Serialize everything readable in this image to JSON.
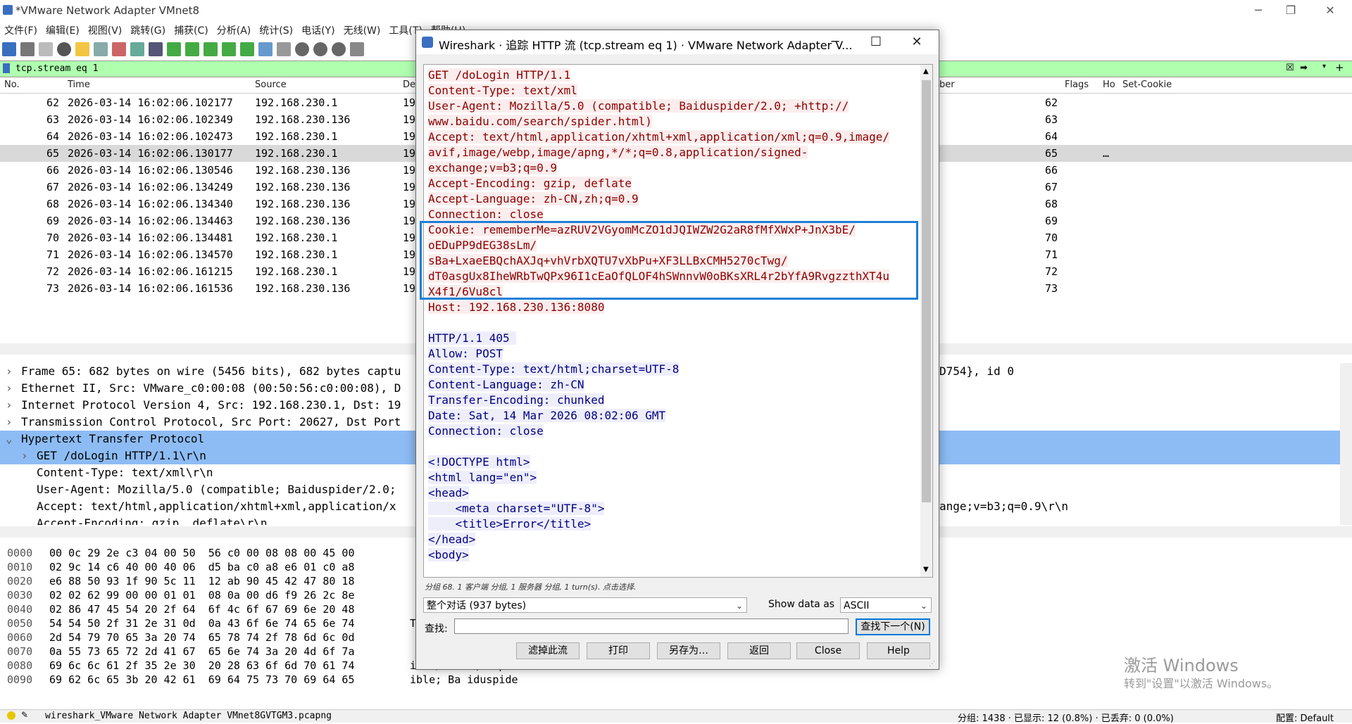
{
  "main_window": {
    "title": "*VMware Network Adapter VMnet8",
    "menu": [
      "文件(F)",
      "编辑(E)",
      "视图(V)",
      "跳转(G)",
      "捕获(C)",
      "分析(A)",
      "统计(S)",
      "电话(Y)",
      "无线(W)",
      "工具(T)",
      "帮助(H)"
    ],
    "filter": "tcp.stream eq 1",
    "columns": {
      "no": "No.",
      "time": "Time",
      "source": "Source",
      "dest": "De",
      "number": "ber",
      "flags": "Flags",
      "ho": "Ho",
      "set_cookie": "Set-Cookie"
    },
    "packets": [
      {
        "no": "62",
        "time": "2026-03-14 16:02:06.102177",
        "src": "192.168.230.1",
        "dst": "19",
        "num": "62",
        "flags": ""
      },
      {
        "no": "63",
        "time": "2026-03-14 16:02:06.102349",
        "src": "192.168.230.136",
        "dst": "19",
        "num": "63",
        "flags": ""
      },
      {
        "no": "64",
        "time": "2026-03-14 16:02:06.102473",
        "src": "192.168.230.1",
        "dst": "19",
        "num": "64",
        "flags": ""
      },
      {
        "no": "65",
        "time": "2026-03-14 16:02:06.130177",
        "src": "192.168.230.1",
        "dst": "19",
        "num": "65",
        "flags": "…"
      },
      {
        "no": "66",
        "time": "2026-03-14 16:02:06.130546",
        "src": "192.168.230.136",
        "dst": "19",
        "num": "66",
        "flags": ""
      },
      {
        "no": "67",
        "time": "2026-03-14 16:02:06.134249",
        "src": "192.168.230.136",
        "dst": "19",
        "num": "67",
        "flags": ""
      },
      {
        "no": "68",
        "time": "2026-03-14 16:02:06.134340",
        "src": "192.168.230.136",
        "dst": "19",
        "num": "68",
        "flags": ""
      },
      {
        "no": "69",
        "time": "2026-03-14 16:02:06.134463",
        "src": "192.168.230.136",
        "dst": "19",
        "num": "69",
        "flags": ""
      },
      {
        "no": "70",
        "time": "2026-03-14 16:02:06.134481",
        "src": "192.168.230.1",
        "dst": "19",
        "num": "70",
        "flags": ""
      },
      {
        "no": "71",
        "time": "2026-03-14 16:02:06.134570",
        "src": "192.168.230.1",
        "dst": "19",
        "num": "71",
        "flags": ""
      },
      {
        "no": "72",
        "time": "2026-03-14 16:02:06.161215",
        "src": "192.168.230.1",
        "dst": "19",
        "num": "72",
        "flags": ""
      },
      {
        "no": "73",
        "time": "2026-03-14 16:02:06.161536",
        "src": "192.168.230.136",
        "dst": "19",
        "num": "73",
        "flags": ""
      }
    ],
    "details": [
      {
        "text": "Frame 65: 682 bytes on wire (5456 bits), 682 bytes captu",
        "right": "D754}, id 0",
        "arrow": "›",
        "indent": 0
      },
      {
        "text": "Ethernet II, Src: VMware_c0:00:08 (00:50:56:c0:00:08), D",
        "right": "",
        "arrow": "›",
        "indent": 0
      },
      {
        "text": "Internet Protocol Version 4, Src: 192.168.230.1, Dst: 19",
        "right": "",
        "arrow": "›",
        "indent": 0
      },
      {
        "text": "Transmission Control Protocol, Src Port: 20627, Dst Port",
        "right": "",
        "arrow": "›",
        "indent": 0
      },
      {
        "text": "Hypertext Transfer Protocol",
        "right": "",
        "arrow": "⌄",
        "indent": 0
      },
      {
        "text": "GET /doLogin HTTP/1.1\\r\\n",
        "right": "",
        "arrow": "›",
        "indent": 1
      },
      {
        "text": "Content-Type: text/xml\\r\\n",
        "right": "",
        "arrow": "",
        "indent": 1
      },
      {
        "text": "User-Agent: Mozilla/5.0 (compatible; Baiduspider/2.0;",
        "right": "",
        "arrow": "",
        "indent": 1
      },
      {
        "text": "Accept: text/html,application/xhtml+xml,application/x",
        "right": "ange;v=b3;q=0.9\\r\\n",
        "arrow": "",
        "indent": 1
      },
      {
        "text": "Accept-Encoding: gzip, deflate\\r\\n",
        "right": "",
        "arrow": "",
        "indent": 1
      }
    ],
    "bytes": [
      {
        "off": "0000",
        "hex": "00 0c 29 2e c3 04 00 50  56 c0 00 08 08 00 45 00",
        "ascii": ""
      },
      {
        "off": "0010",
        "hex": "02 9c 14 c6 40 00 40 06  d5 ba c0 a8 e6 01 c0 a8",
        "ascii": ""
      },
      {
        "off": "0020",
        "hex": "e6 88 50 93 1f 90 5c 11  12 ab 90 45 42 47 80 18",
        "ascii": ""
      },
      {
        "off": "0030",
        "hex": "02 02 62 99 00 00 01 01  08 0a 00 d6 f9 26 2c 8e",
        "ascii": ""
      },
      {
        "off": "0040",
        "hex": "02 86 47 45 54 20 2f 64  6f 4c 6f 67 69 6e 20 48",
        "ascii": ""
      },
      {
        "off": "0050",
        "hex": "54 54 50 2f 31 2e 31 0d  0a 43 6f 6e 74 65 6e 74",
        "ascii": "T"
      },
      {
        "off": "0060",
        "hex": "2d 54 79 70 65 3a 20 74  65 78 74 2f 78 6d 6c 0d",
        "ascii": ""
      },
      {
        "off": "0070",
        "hex": "0a 55 73 65 72 2d 41 67  65 6e 74 3a 20 4d 6f 7a",
        "ascii": ""
      },
      {
        "off": "0080",
        "hex": "69 6c 6c 61 2f 35 2e 30  20 28 63 6f 6d 70 61 74",
        "ascii": "illa/5.0  (compat"
      },
      {
        "off": "0090",
        "hex": "69 62 6c 65 3b 20 42 61  69 64 75 73 70 69 64 65",
        "ascii": "ible; Ba iduspide"
      }
    ],
    "status": {
      "file": "wireshark_VMware Network Adapter VMnet8GVTGM3.pcapng",
      "packets": "分组: 1438 · 已显示: 12 (0.8%) · 已丢弃: 0 (0.0%)",
      "profile": "配置: Default"
    },
    "watermark": {
      "line1": "激活 Windows",
      "line2": "转到\"设置\"以激活 Windows。"
    }
  },
  "dialog": {
    "title": "Wireshark · 追踪 HTTP 流 (tcp.stream eq 1) · VMware Network Adapter V...",
    "stream_lines": [
      {
        "t": "GET /doLogin HTTP/1.1",
        "c": "cli"
      },
      {
        "t": "Content-Type: text/xml",
        "c": "cli"
      },
      {
        "t": "User-Agent: Mozilla/5.0 (compatible; Baiduspider/2.0; +http://",
        "c": "cli"
      },
      {
        "t": "www.baidu.com/search/spider.html)",
        "c": "cli"
      },
      {
        "t": "Accept: text/html,application/xhtml+xml,application/xml;q=0.9,image/",
        "c": "cli"
      },
      {
        "t": "avif,image/webp,image/apng,*/*;q=0.8,application/signed-",
        "c": "cli"
      },
      {
        "t": "exchange;v=b3;q=0.9",
        "c": "cli"
      },
      {
        "t": "Accept-Encoding: gzip, deflate",
        "c": "cli"
      },
      {
        "t": "Accept-Language: zh-CN,zh;q=0.9",
        "c": "cli"
      },
      {
        "t": "Connection: close",
        "c": "cli"
      },
      {
        "t": "Cookie: rememberMe=azRUV2VGyomMcZO1dJQIWZW2G2aR8fMfXWxP+JnX3bE/",
        "c": "cli"
      },
      {
        "t": "oEDuPP9dEG38sLm/",
        "c": "cli"
      },
      {
        "t": "sBa+LxaeEBQchAXJq+vhVrbXQTU7vXbPu+XF3LLBxCMH5270cTwg/",
        "c": "cli"
      },
      {
        "t": "dT0asgUx8IheWRbTwQPx96I1cEaOfQLOF4hSWnnvW0oBKsXRL4r2bYfA9RvgzzthXT4u",
        "c": "cli"
      },
      {
        "t": "X4f1/6Vu8cl",
        "c": "cli"
      },
      {
        "t": "Host: 192.168.230.136:8080",
        "c": "cli"
      },
      {
        "t": "",
        "c": ""
      },
      {
        "t": "HTTP/1.1 405 ",
        "c": "srv"
      },
      {
        "t": "Allow: POST",
        "c": "srv"
      },
      {
        "t": "Content-Type: text/html;charset=UTF-8",
        "c": "srv"
      },
      {
        "t": "Content-Language: zh-CN",
        "c": "srv"
      },
      {
        "t": "Transfer-Encoding: chunked",
        "c": "srv"
      },
      {
        "t": "Date: Sat, 14 Mar 2026 08:02:06 GMT",
        "c": "srv"
      },
      {
        "t": "Connection: close",
        "c": "srv"
      },
      {
        "t": "",
        "c": ""
      },
      {
        "t": "<!DOCTYPE html>",
        "c": "srv"
      },
      {
        "t": "<html lang=\"en\">",
        "c": "srv"
      },
      {
        "t": "<head>",
        "c": "srv"
      },
      {
        "t": "    <meta charset=\"UTF-8\">",
        "c": "srv"
      },
      {
        "t": "    <title>Error</title>",
        "c": "srv"
      },
      {
        "t": "</head>",
        "c": "srv"
      },
      {
        "t": "<body>",
        "c": "srv"
      }
    ],
    "info": "分组 68. 1 客户端 分组, 1 服务器 分组, 1 turn(s). 点击选择.",
    "conversation": "整个对话 (937 bytes)",
    "show_as_label": "Show data as",
    "encoding": "ASCII",
    "find_label": "查找:",
    "find_next": "查找下一个(N)",
    "buttons": {
      "filter": "滤掉此流",
      "print": "打印",
      "save_as": "另存为…",
      "back": "返回",
      "close": "Close",
      "help": "Help"
    },
    "colors": {
      "client": "#8b0000",
      "server": "#000080",
      "highlight": "#1e7fd8"
    }
  }
}
